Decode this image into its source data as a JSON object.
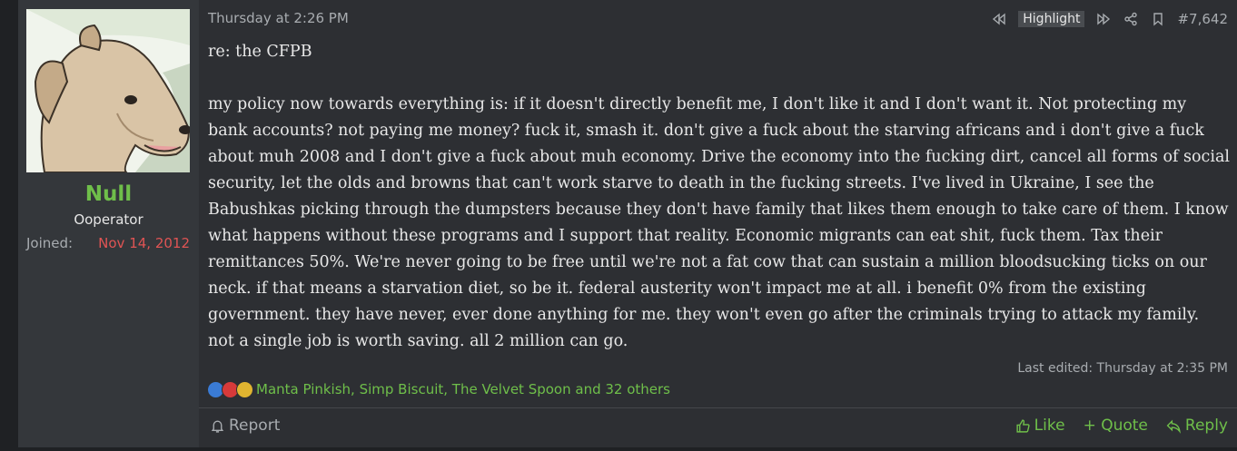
{
  "user": {
    "name": "Null",
    "title": "Ooperator",
    "joined_label": "Joined:",
    "joined_value": "Nov 14, 2012"
  },
  "post": {
    "date": "Thursday at 2:26 PM",
    "highlight_label": "Highlight",
    "number": "#7,642",
    "line1": "re: the CFPB",
    "paragraph": "my policy now towards everything is: if it doesn't directly benefit me, I don't like it and I don't want it. Not protecting my bank accounts? not paying me money? fuck it, smash it. don't give a fuck about the starving africans and i don't give a fuck about muh 2008 and I don't give a fuck about muh economy. Drive the economy into the fucking dirt, cancel all forms of social security, let the olds and browns that can't work starve to death in the fucking streets. I've lived in Ukraine, I see the Babushkas picking through the dumpsters because they don't have family that likes them enough to take care of them. I know what happens without these programs and I support that reality. Economic migrants can eat shit, fuck them. Tax their remittances 50%. We're never going to be free until we're not a fat cow that can sustain a million bloodsucking ticks on our neck. if that means a starvation diet, so be it. federal austerity won't impact me at all. i benefit 0% from the existing government. they have never, ever done anything for me. they won't even go after the criminals trying to attack my family. not a single job is worth saving. all 2 million can go.",
    "last_edited": "Last edited: Thursday at 2:35 PM",
    "reactions_text": "Manta Pinkish, Simp Biscuit, The Velvet Spoon and 32 others"
  },
  "footer": {
    "report": "Report",
    "like": "Like",
    "quote": "+ Quote",
    "reply": "Reply"
  },
  "colors": {
    "accent_green": "#6fbf4a",
    "joined_red": "#e05454",
    "background": "#2d2f33"
  }
}
